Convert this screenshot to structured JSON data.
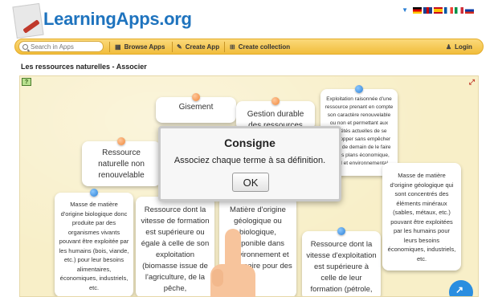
{
  "header": {
    "logo_text": "LearningApps.org",
    "languages": [
      "de",
      "en",
      "es",
      "fr",
      "it",
      "ru"
    ]
  },
  "nav": {
    "search_placeholder": "Search in Apps",
    "browse": "Browse Apps",
    "create": "Create App",
    "collection": "Create collection",
    "login": "Login"
  },
  "page": {
    "title": "Les ressources naturelles - Associer"
  },
  "app": {
    "terms": [
      "Gisement",
      "Gestion durable des ressources",
      "Ressource naturelle non renouvelable"
    ],
    "definitions": [
      "Exploitation raisonnée d'une ressource prenant en compte son caractère renouvelable ou non et permettant aux sociétés actuelles de se développer sans empêcher celles de demain de le faire sur les plans économique, social et environnemental.",
      "Masse de matière d'origine biologique donc produite par des organismes vivants pouvant être exploitée par les humains (bois, viande, etc.) pour leur besoins alimentaires, économiques, industriels, etc.",
      "Ressource dont la vitesse de formation est supérieure ou égale à celle de son exploitation (biomasse issue de l'agriculture, de la pêche,",
      "Matière d'origine géologique ou biologique, disponible dans l'environnement et nécessaire pour des",
      "Ressource dont la vitesse d'exploitation est supérieure à celle de leur formation (pétrole,",
      "Masse de matière d'origine géologique qui sont concentrés des éléments minéraux (sables, métaux, etc.) pouvant être exploitées par les humains pour leurs besoins économiques, industriels, etc."
    ]
  },
  "modal": {
    "title": "Consigne",
    "message": "Associez chaque terme à sa définition.",
    "ok": "OK"
  },
  "colors": {
    "navbar": "#f1bd3c",
    "app_bg": "#f8efc8",
    "pin_orange": "#f0873a",
    "pin_blue": "#2b7fd4",
    "logo": "#1e73be"
  }
}
